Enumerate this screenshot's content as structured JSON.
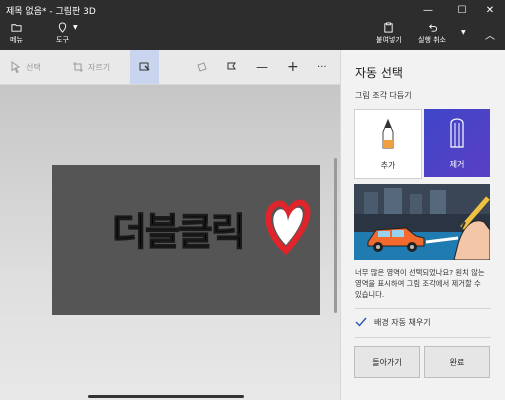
{
  "window": {
    "title": "제목 없음* - 그림판 3D",
    "controls": {
      "minimize": "—",
      "maximize": "☐",
      "close": "✕"
    }
  },
  "topbar": {
    "menu_label": "메뉴",
    "tools_label": "도구",
    "paste_label": "붙여넣기",
    "undo_label": "실행 취소"
  },
  "toolbar": {
    "select_label": "선택",
    "crop_label": "자르기",
    "zoom_minus": "—",
    "zoom_plus": "+",
    "more": "···"
  },
  "canvas": {
    "handwriting": "더블클릭"
  },
  "panel": {
    "title": "자동 선택",
    "subtitle": "그림 조각 다듬기",
    "add_label": "추가",
    "remove_label": "제거",
    "description": "너무 많은 영역이 선택되었나요? 원치 않는 영역을 표시하여 그림 조각에서 제거할 수 있습니다.",
    "autofill_label": "배경 자동 채우기",
    "autofill_checked": true,
    "back_button": "돌아가기",
    "done_button": "완료"
  },
  "colors": {
    "accent": "#4a44c8",
    "titlebar": "#2d2d2d",
    "canvas": "#555555",
    "heart": "#e0242c"
  }
}
